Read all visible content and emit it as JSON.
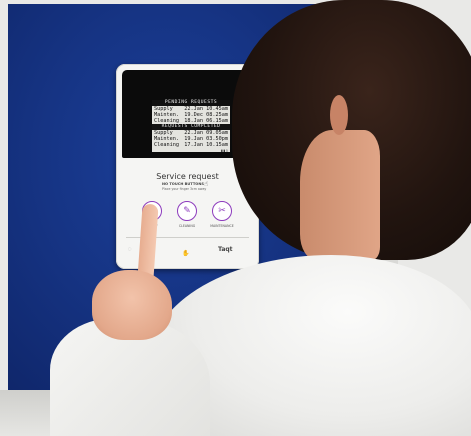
{
  "device": {
    "screen": {
      "pending_header": "PENDING REQUESTS",
      "pending": [
        {
          "name": "Supply",
          "time": "22.Jan 10.45am"
        },
        {
          "name": "Mainten.",
          "time": "19.Dec 08.25am"
        },
        {
          "name": "Cleaning",
          "time": "18.Jan 06.15am"
        }
      ],
      "completed_header": "REQUESTS COMPLETED",
      "completed": [
        {
          "name": "Supply",
          "time": "22.Jan 09.05am"
        },
        {
          "name": "Mainten.",
          "time": "19.Jan 03.50pm"
        },
        {
          "name": "Cleaning",
          "time": "17.Jan 10.15am"
        }
      ]
    },
    "title": "Service request",
    "no_touch": "NO TOUCH BUTTONS",
    "hint": "Place your finger 3cm away",
    "buttons": [
      {
        "label": "SUPPLY",
        "icon": "roll-icon"
      },
      {
        "label": "CLEANING",
        "icon": "cleaning-icon"
      },
      {
        "label": "MAINTENANCE",
        "icon": "tools-icon"
      }
    ],
    "brand": "Taqt"
  }
}
